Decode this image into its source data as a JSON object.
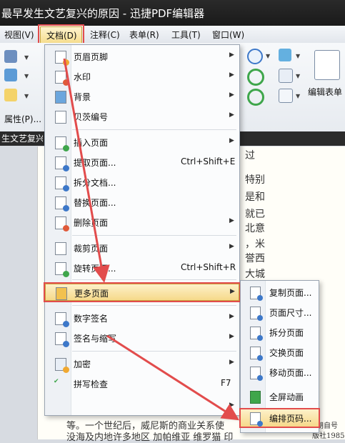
{
  "window": {
    "title": "最早发生文艺复兴的原因 - 迅捷PDF编辑器"
  },
  "menubar": {
    "items": [
      "视图(V)",
      "文档(D)",
      "注释(C)",
      "表单(R)",
      "工具(T)",
      "窗口(W)"
    ]
  },
  "toolbar": {
    "properties_label": "属性(P)...",
    "edit_form_label": "编辑表单"
  },
  "document_tab": {
    "label": "生文艺复兴"
  },
  "page_text": [
    "过",
    "特别",
    "是和",
    "就已",
    "北意",
    "，米",
    "誉西",
    "大城",
    "等。一个世纪后，威尼斯的商业关系使",
    "没海及内地许多地区 加帕维亚 维罗猫 印",
    "胡自号",
    "版社1985"
  ],
  "document_menu": {
    "items": [
      {
        "label": "页眉页脚",
        "shortcut": "",
        "has_submenu": true,
        "icon": "header-footer-icon"
      },
      {
        "label": "水印",
        "shortcut": "",
        "has_submenu": true,
        "icon": "watermark-icon"
      },
      {
        "label": "背景",
        "shortcut": "",
        "has_submenu": true,
        "icon": "background-icon"
      },
      {
        "label": "贝茨编号",
        "shortcut": "",
        "has_submenu": true,
        "icon": "bates-numbering-icon"
      },
      {
        "label": "插入页面",
        "shortcut": "",
        "has_submenu": true,
        "icon": "insert-page-icon"
      },
      {
        "label": "提取页面...",
        "shortcut": "Ctrl+Shift+E",
        "has_submenu": false,
        "icon": "extract-page-icon"
      },
      {
        "label": "拆分文档...",
        "shortcut": "",
        "has_submenu": false,
        "icon": "split-document-icon"
      },
      {
        "label": "替换页面...",
        "shortcut": "",
        "has_submenu": false,
        "icon": "replace-page-icon"
      },
      {
        "label": "删除页面",
        "shortcut": "",
        "has_submenu": true,
        "icon": "delete-page-icon"
      },
      {
        "label": "裁剪页面",
        "shortcut": "",
        "has_submenu": true,
        "icon": "crop-page-icon"
      },
      {
        "label": "旋转页面...",
        "shortcut": "Ctrl+Shift+R",
        "has_submenu": false,
        "icon": "rotate-page-icon"
      },
      {
        "label": "更多页面",
        "shortcut": "",
        "has_submenu": true,
        "icon": "more-pages-icon"
      },
      {
        "label": "数字签名",
        "shortcut": "",
        "has_submenu": true,
        "icon": "digital-signature-icon"
      },
      {
        "label": "签名与缩写",
        "shortcut": "",
        "has_submenu": true,
        "icon": "signature-initials-icon"
      },
      {
        "label": "加密",
        "shortcut": "",
        "has_submenu": true,
        "icon": "encrypt-icon"
      },
      {
        "label": "拼写检查",
        "shortcut": "F7",
        "has_submenu": false,
        "icon": "spell-check-icon"
      }
    ]
  },
  "more_pages_submenu": {
    "items": [
      {
        "label": "复制页面...",
        "icon": "copy-page-icon"
      },
      {
        "label": "页面尺寸...",
        "icon": "page-size-icon"
      },
      {
        "label": "拆分页面",
        "icon": "split-page-icon"
      },
      {
        "label": "交换页面",
        "icon": "swap-page-icon"
      },
      {
        "label": "移动页面...",
        "icon": "move-page-icon"
      },
      {
        "label": "全屏动画",
        "icon": "fullscreen-animation-icon"
      },
      {
        "label": "编排页码...",
        "icon": "page-numbering-icon"
      }
    ]
  },
  "colors": {
    "highlight_border": "#e24c4c",
    "highlight_fill": "#f6d98a",
    "arrow": "#e24c4c"
  }
}
